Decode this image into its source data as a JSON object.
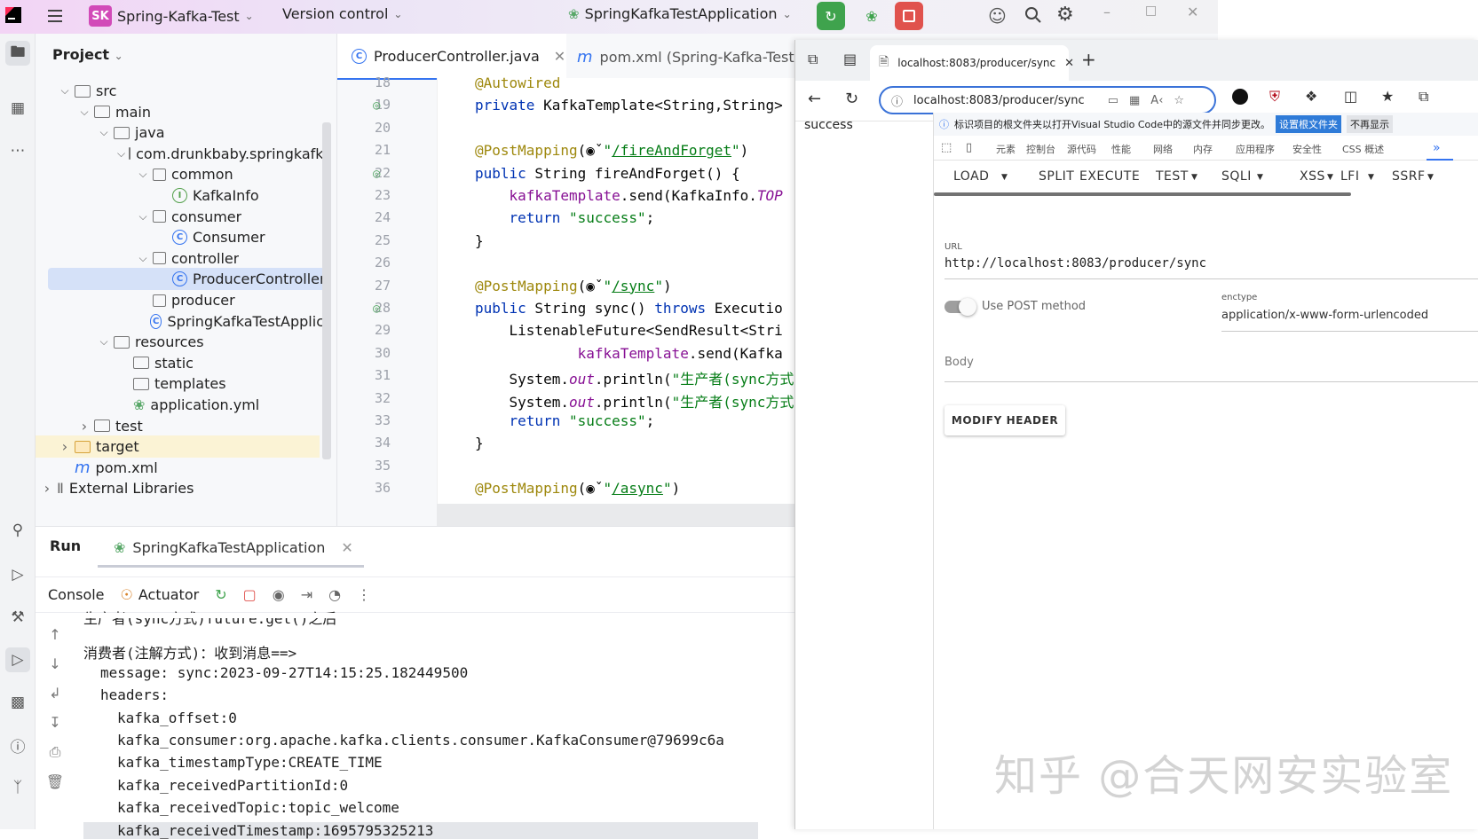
{
  "ide": {
    "project_badge": "SK",
    "project_name": "Spring-Kafka-Test",
    "vcs": "Version control",
    "run_config": "SpringKafkaTestApplication",
    "project_panel_title": "Project",
    "tree": [
      {
        "label": "src",
        "depth": 0,
        "type": "folder",
        "open": true
      },
      {
        "label": "main",
        "depth": 1,
        "type": "folder",
        "open": true
      },
      {
        "label": "java",
        "depth": 2,
        "type": "folder",
        "open": true
      },
      {
        "label": "com.drunkbaby.springkafka",
        "depth": 3,
        "type": "package",
        "open": true
      },
      {
        "label": "common",
        "depth": 4,
        "type": "package",
        "open": true
      },
      {
        "label": "KafkaInfo",
        "depth": 5,
        "type": "interface"
      },
      {
        "label": "consumer",
        "depth": 4,
        "type": "package",
        "open": true
      },
      {
        "label": "Consumer",
        "depth": 5,
        "type": "class"
      },
      {
        "label": "controller",
        "depth": 4,
        "type": "package",
        "open": true
      },
      {
        "label": "ProducerController",
        "depth": 5,
        "type": "class",
        "selected": true
      },
      {
        "label": "producer",
        "depth": 4,
        "type": "package"
      },
      {
        "label": "SpringKafkaTestApplic",
        "depth": 4,
        "type": "class"
      },
      {
        "label": "resources",
        "depth": 2,
        "type": "folder",
        "open": true
      },
      {
        "label": "static",
        "depth": 3,
        "type": "folder"
      },
      {
        "label": "templates",
        "depth": 3,
        "type": "folder"
      },
      {
        "label": "application.yml",
        "depth": 3,
        "type": "yml"
      },
      {
        "label": "test",
        "depth": 1,
        "type": "folder",
        "closed": true
      },
      {
        "label": "target",
        "depth": 0,
        "type": "folder-target",
        "closed": true
      },
      {
        "label": "pom.xml",
        "depth": 0,
        "type": "maven"
      },
      {
        "label": "External Libraries",
        "depth": -1,
        "type": "lib",
        "closed": true
      }
    ],
    "tabs": [
      {
        "label": "ProducerController.java",
        "active": true
      },
      {
        "label": "pom.xml (Spring-Kafka-Test)",
        "active": false
      }
    ],
    "code_lines": [
      {
        "n": "18",
        "html": "<span class='ann'>@Autowired</span>"
      },
      {
        "n": "19",
        "html": "<span class='kw'>private</span> KafkaTemplate&lt;String,String&gt;"
      },
      {
        "n": "20",
        "html": ""
      },
      {
        "n": "21",
        "html": "<span class='ann'>@PostMapping</span>(&#9673;&#711;<span class='str'>\"<u>/fireAndForget</u>\"</span>)"
      },
      {
        "n": "22",
        "html": "<span class='kw'>public</span> String fireAndForget() {"
      },
      {
        "n": "23",
        "html": "    <span class='fld'>kafkaTemplate</span>.send(KafkaInfo.<span class='fld it'>TOP</span>"
      },
      {
        "n": "24",
        "html": "    <span class='kw'>return</span> <span class='str'>\"success\"</span>;"
      },
      {
        "n": "25",
        "html": "}"
      },
      {
        "n": "26",
        "html": ""
      },
      {
        "n": "27",
        "html": "<span class='ann'>@PostMapping</span>(&#9673;&#711;<span class='str'>\"<u>/sync</u>\"</span>)"
      },
      {
        "n": "28",
        "html": "<span class='kw'>public</span> String sync() <span class='kw'>throws</span> Executio"
      },
      {
        "n": "29",
        "html": "    ListenableFuture&lt;SendResult&lt;Stri"
      },
      {
        "n": "30",
        "html": "            <span class='fld'>kafkaTemplate</span>.send(Kafka"
      },
      {
        "n": "31",
        "html": "    System.<span class='fld it'>out</span>.println(<span class='str'>\"生产者(sync方式</span>"
      },
      {
        "n": "32",
        "html": "    System.<span class='fld it'>out</span>.println(<span class='str'>\"生产者(sync方式</span>"
      },
      {
        "n": "33",
        "html": "    <span class='kw'>return</span> <span class='str'>\"success\"</span>;"
      },
      {
        "n": "34",
        "html": "}"
      },
      {
        "n": "35",
        "html": ""
      },
      {
        "n": "36",
        "html": "<span class='ann'>@PostMapping</span>(&#9673;&#711;<span class='str'>\"<u>/async</u>\"</span>)"
      }
    ],
    "run_panel": {
      "title": "Run",
      "tab": "SpringKafkaTestApplication",
      "console_tab": "Console",
      "actuator_tab": "Actuator",
      "lines": [
        {
          "text": "生产者(sync方式)future.get()之后",
          "indent": 0,
          "cut": true
        },
        {
          "text": "消费者(注解方式)：收到消息==>",
          "indent": 0
        },
        {
          "text": "message: sync:2023-09-27T14:15:25.182449500",
          "indent": 1
        },
        {
          "text": "headers:",
          "indent": 1
        },
        {
          "text": "kafka_offset:0",
          "indent": 2
        },
        {
          "text": "kafka_consumer:org.apache.kafka.clients.consumer.KafkaConsumer@79699c6a",
          "indent": 2
        },
        {
          "text": "kafka_timestampType:CREATE_TIME",
          "indent": 2
        },
        {
          "text": "kafka_receivedPartitionId:0",
          "indent": 2
        },
        {
          "text": "kafka_receivedTopic:topic_welcome",
          "indent": 2
        },
        {
          "text": "kafka_receivedTimestamp:1695795325213",
          "indent": 2,
          "cut": true
        }
      ]
    }
  },
  "browser": {
    "tab_title": "localhost:8083/producer/sync",
    "address": "localhost:8083/producer/sync",
    "page_body": "success",
    "infobar": "标识项目的根文件夹以打开Visual Studio Code中的源文件并同步更改。",
    "infobar_btn1": "设置根文件夹",
    "infobar_btn2": "不再显示",
    "devtools_tabs": [
      "元素",
      "控制台",
      "源代码",
      "性能",
      "网络",
      "内存",
      "应用程序",
      "安全性",
      "CSS 概述"
    ],
    "hackbar_menu": [
      "LOAD",
      "SPLIT",
      "EXECUTE",
      "TEST",
      "SQLI",
      "XSS",
      "LFI",
      "SSRF"
    ],
    "url_label": "URL",
    "url_value": "http://localhost:8083/producer/sync",
    "post_label": "Use POST method",
    "enctype_label": "enctype",
    "enctype_value": "application/x-www-form-urlencoded",
    "body_label": "Body",
    "modify_header": "MODIFY HEADER"
  },
  "watermark": "知乎 @合天网安实验室"
}
